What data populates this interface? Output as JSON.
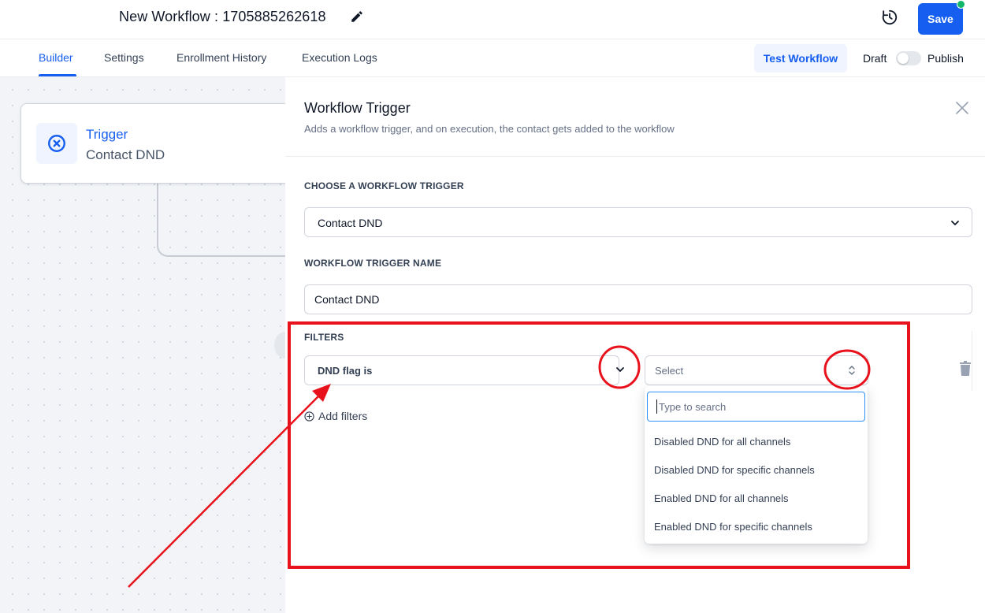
{
  "header": {
    "title": "New Workflow : 1705885262618",
    "save_label": "Save"
  },
  "tabs": {
    "builder": "Builder",
    "settings": "Settings",
    "enrollment_history": "Enrollment History",
    "execution_logs": "Execution Logs",
    "test_workflow": "Test Workflow",
    "draft": "Draft",
    "publish": "Publish",
    "publish_enabled": false
  },
  "canvas": {
    "trigger_title": "Trigger",
    "trigger_subtitle": "Contact DND"
  },
  "panel": {
    "title": "Workflow Trigger",
    "description": "Adds a workflow trigger, and on execution, the contact gets added to the workflow",
    "choose_label": "CHOOSE A WORKFLOW TRIGGER",
    "chosen_trigger": "Contact DND",
    "name_label": "WORKFLOW TRIGGER NAME",
    "name_value": "Contact DND",
    "filters_label": "FILTERS",
    "filter_field": "DND flag is",
    "filter_value_placeholder": "Select",
    "add_filters": "Add filters"
  },
  "dropdown": {
    "search_placeholder": "Type to search",
    "options": [
      "Disabled DND for all channels",
      "Disabled DND for specific channels",
      "Enabled DND for all channels",
      "Enabled DND for specific channels"
    ]
  },
  "colors": {
    "primary": "#155eef",
    "annotation": "#e8121c",
    "status_dot": "#12b76a"
  }
}
